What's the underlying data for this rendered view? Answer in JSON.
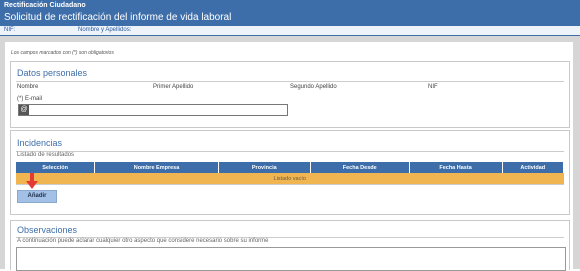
{
  "header": {
    "app_name": "Rectificación Ciudadano",
    "page_title": "Solicitud de rectificación del informe de vida laboral"
  },
  "infobar": {
    "nif_label": "NIF:",
    "name_label": "Nombre y Apellidos:"
  },
  "form": {
    "mandatory_note": "Los campos marcados con (*) son obligatorios"
  },
  "personal": {
    "title": "Datos personales",
    "fields": [
      "Nombre",
      "Primer Apellido",
      "Segundo Apellido",
      "NIF"
    ],
    "email_label": "(*) E-mail",
    "email_value": "",
    "email_icon": "at-icon"
  },
  "incidencias": {
    "title": "Incidencias",
    "list_label": "Listado de resultados",
    "columns": [
      "Selección",
      "Nombre Empresa",
      "Provincia",
      "Fecha Desde",
      "Fecha Hasta",
      "Actividad"
    ],
    "empty_text": "Listado vacío",
    "add_button": "Añadir",
    "row_color": "#f0b550",
    "header_color": "#3e6ea9"
  },
  "observaciones": {
    "title": "Observaciones",
    "help_text": "A continuación puede aclarar cualquier otro aspecto que considere necesario sobre su informe",
    "value": ""
  },
  "annotation": {
    "arrow_color": "#e53935",
    "arrow_icon": "arrow-down-icon"
  }
}
